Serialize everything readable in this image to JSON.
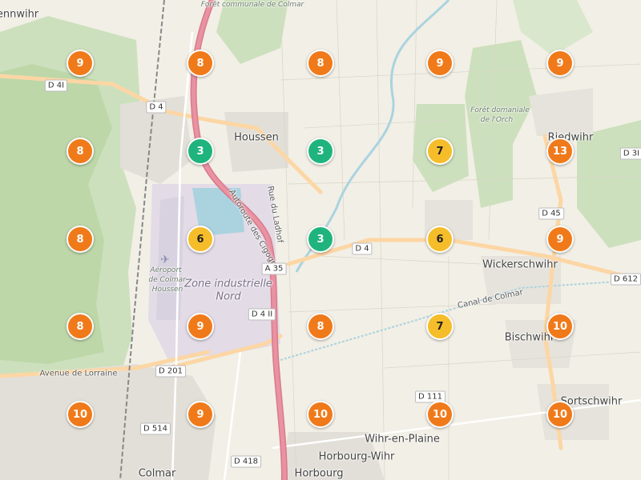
{
  "colors": {
    "land": "#f2efe6",
    "forest": "#cde0bd",
    "forest_dark": "#b6d3a1",
    "industrial": "#e3dbe6",
    "urban": "#e2dfd8",
    "water": "#aad3df",
    "motorway": "#e892a2",
    "primary": "#fcd6a4",
    "cluster_high": "#f07a1a",
    "cluster_mid": "#f6bd2b",
    "cluster_low": "#1fb47d"
  },
  "places": [
    {
      "name": "Houssen",
      "size": "big"
    },
    {
      "name": "Wickerschwihr",
      "size": "big"
    },
    {
      "name": "Bischwihr",
      "size": "big"
    },
    {
      "name": "Sortschwihr",
      "size": "big"
    },
    {
      "name": "Wihr-en-Plaine",
      "size": "big"
    },
    {
      "name": "Horbourg-Wihr",
      "size": "big"
    },
    {
      "name": "Horbourg",
      "size": "big"
    },
    {
      "name": "Colmar",
      "size": "big"
    },
    {
      "name": "Riedwihr",
      "size": "big"
    },
    {
      "name": "Zone industrielle",
      "size": "zone"
    },
    {
      "name": "Nord",
      "size": "zone"
    },
    {
      "name": "Aéroport",
      "size": "it"
    },
    {
      "name": "de Colmar-",
      "size": "it"
    },
    {
      "name": "Houssen",
      "size": "it"
    },
    {
      "name": "Forêt domaniale",
      "size": "it"
    },
    {
      "name": "de l'Orch",
      "size": "it"
    },
    {
      "name": "Forêt communale de Colmar",
      "size": "it"
    },
    {
      "name": "Avenue de Lorraine",
      "size": "small"
    },
    {
      "name": "Autoroute des Cigognes",
      "size": "small"
    },
    {
      "name": "Rue du Ladhof",
      "size": "small"
    },
    {
      "name": "Canal de Colmar",
      "size": "small"
    },
    {
      "name": "ennwihr",
      "size": "big"
    }
  ],
  "roads": [
    "D 4I",
    "D 4",
    "A 35",
    "D 4 II",
    "D 201",
    "D 514",
    "D 418",
    "D 111",
    "D 45",
    "D 612",
    "D 3I",
    "D 4"
  ],
  "clusters": [
    {
      "count": "9",
      "level": "high"
    },
    {
      "count": "8",
      "level": "high"
    },
    {
      "count": "8",
      "level": "high"
    },
    {
      "count": "9",
      "level": "high"
    },
    {
      "count": "9",
      "level": "high"
    },
    {
      "count": "8",
      "level": "high"
    },
    {
      "count": "3",
      "level": "low"
    },
    {
      "count": "3",
      "level": "low"
    },
    {
      "count": "7",
      "level": "mid"
    },
    {
      "count": "13",
      "level": "high"
    },
    {
      "count": "8",
      "level": "high"
    },
    {
      "count": "6",
      "level": "mid"
    },
    {
      "count": "3",
      "level": "low"
    },
    {
      "count": "6",
      "level": "mid"
    },
    {
      "count": "9",
      "level": "high"
    },
    {
      "count": "8",
      "level": "high"
    },
    {
      "count": "9",
      "level": "high"
    },
    {
      "count": "8",
      "level": "high"
    },
    {
      "count": "7",
      "level": "mid"
    },
    {
      "count": "10",
      "level": "high"
    },
    {
      "count": "10",
      "level": "high"
    },
    {
      "count": "9",
      "level": "high"
    },
    {
      "count": "10",
      "level": "high"
    },
    {
      "count": "10",
      "level": "high"
    },
    {
      "count": "10",
      "level": "high"
    }
  ]
}
